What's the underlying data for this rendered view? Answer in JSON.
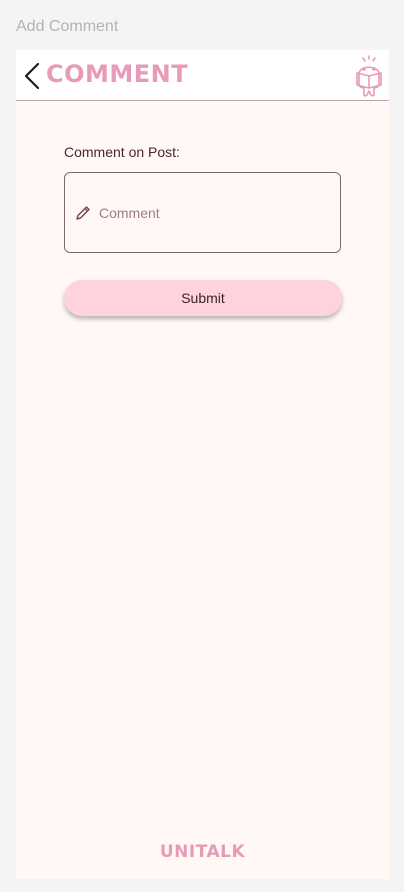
{
  "frame": {
    "title": "Add Comment"
  },
  "header": {
    "title": "comment",
    "back_icon": "chevron-left-icon",
    "mascot_icon": "reading-mascot-icon"
  },
  "form": {
    "label": "Comment on Post:",
    "comment_placeholder": "Comment",
    "comment_value": "",
    "pencil_icon": "pencil-icon",
    "submit_label": "Submit"
  },
  "footer": {
    "brand": "UNITALK"
  },
  "colors": {
    "accent_pink": "#e89bb8",
    "button_pink": "#ffd3de",
    "screen_bg": "#fff8f4",
    "text_dark": "#4a2633"
  }
}
